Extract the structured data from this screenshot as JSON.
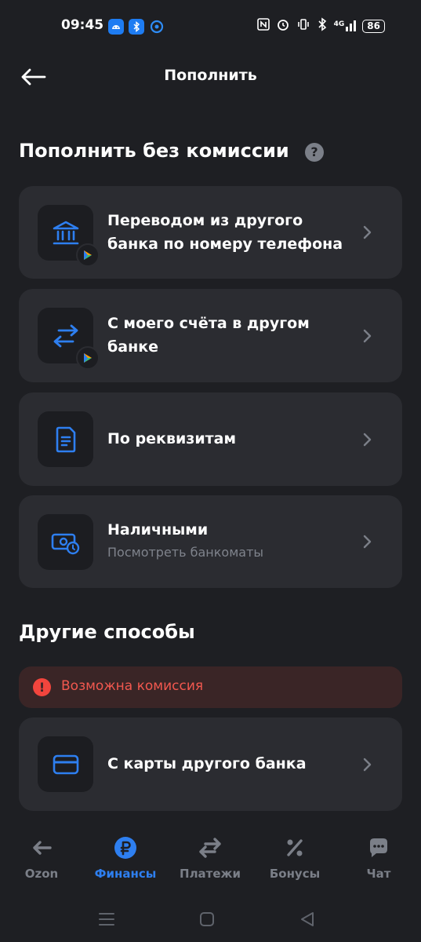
{
  "status_bar": {
    "time": "09:45",
    "battery": "86",
    "network": "4G"
  },
  "header": {
    "title": "Пополнить"
  },
  "section_free": {
    "title": "Пополнить без комиссии",
    "help_glyph": "?"
  },
  "cards": [
    {
      "label": "Переводом из другого банка по номеру телефона",
      "icon": "bank-icon"
    },
    {
      "label": "С моего счёта в другом банке",
      "icon": "transfer-arrows-icon"
    },
    {
      "label": "По реквизитам",
      "icon": "document-icon"
    },
    {
      "label": "Наличными",
      "sublabel": "Посмотреть банкоматы",
      "icon": "cash-icon"
    }
  ],
  "section_other": {
    "title": "Другие способы",
    "warning": "Возможна комиссия",
    "warning_glyph": "!"
  },
  "other_cards": [
    {
      "label": "С карты другого банка",
      "icon": "card-icon"
    }
  ],
  "tabs": [
    {
      "label": "Ozon",
      "icon": "arrow-left-icon"
    },
    {
      "label": "Финансы",
      "icon": "ruble-icon",
      "active": true
    },
    {
      "label": "Платежи",
      "icon": "payments-arrows-icon"
    },
    {
      "label": "Бонусы",
      "icon": "percent-icon"
    },
    {
      "label": "Чат",
      "icon": "chat-icon"
    }
  ],
  "colors": {
    "background": "#1e1f23",
    "card": "#2b2c31",
    "accent": "#2e7ff0",
    "warning": "#f2453d",
    "muted": "#7b7f88"
  }
}
